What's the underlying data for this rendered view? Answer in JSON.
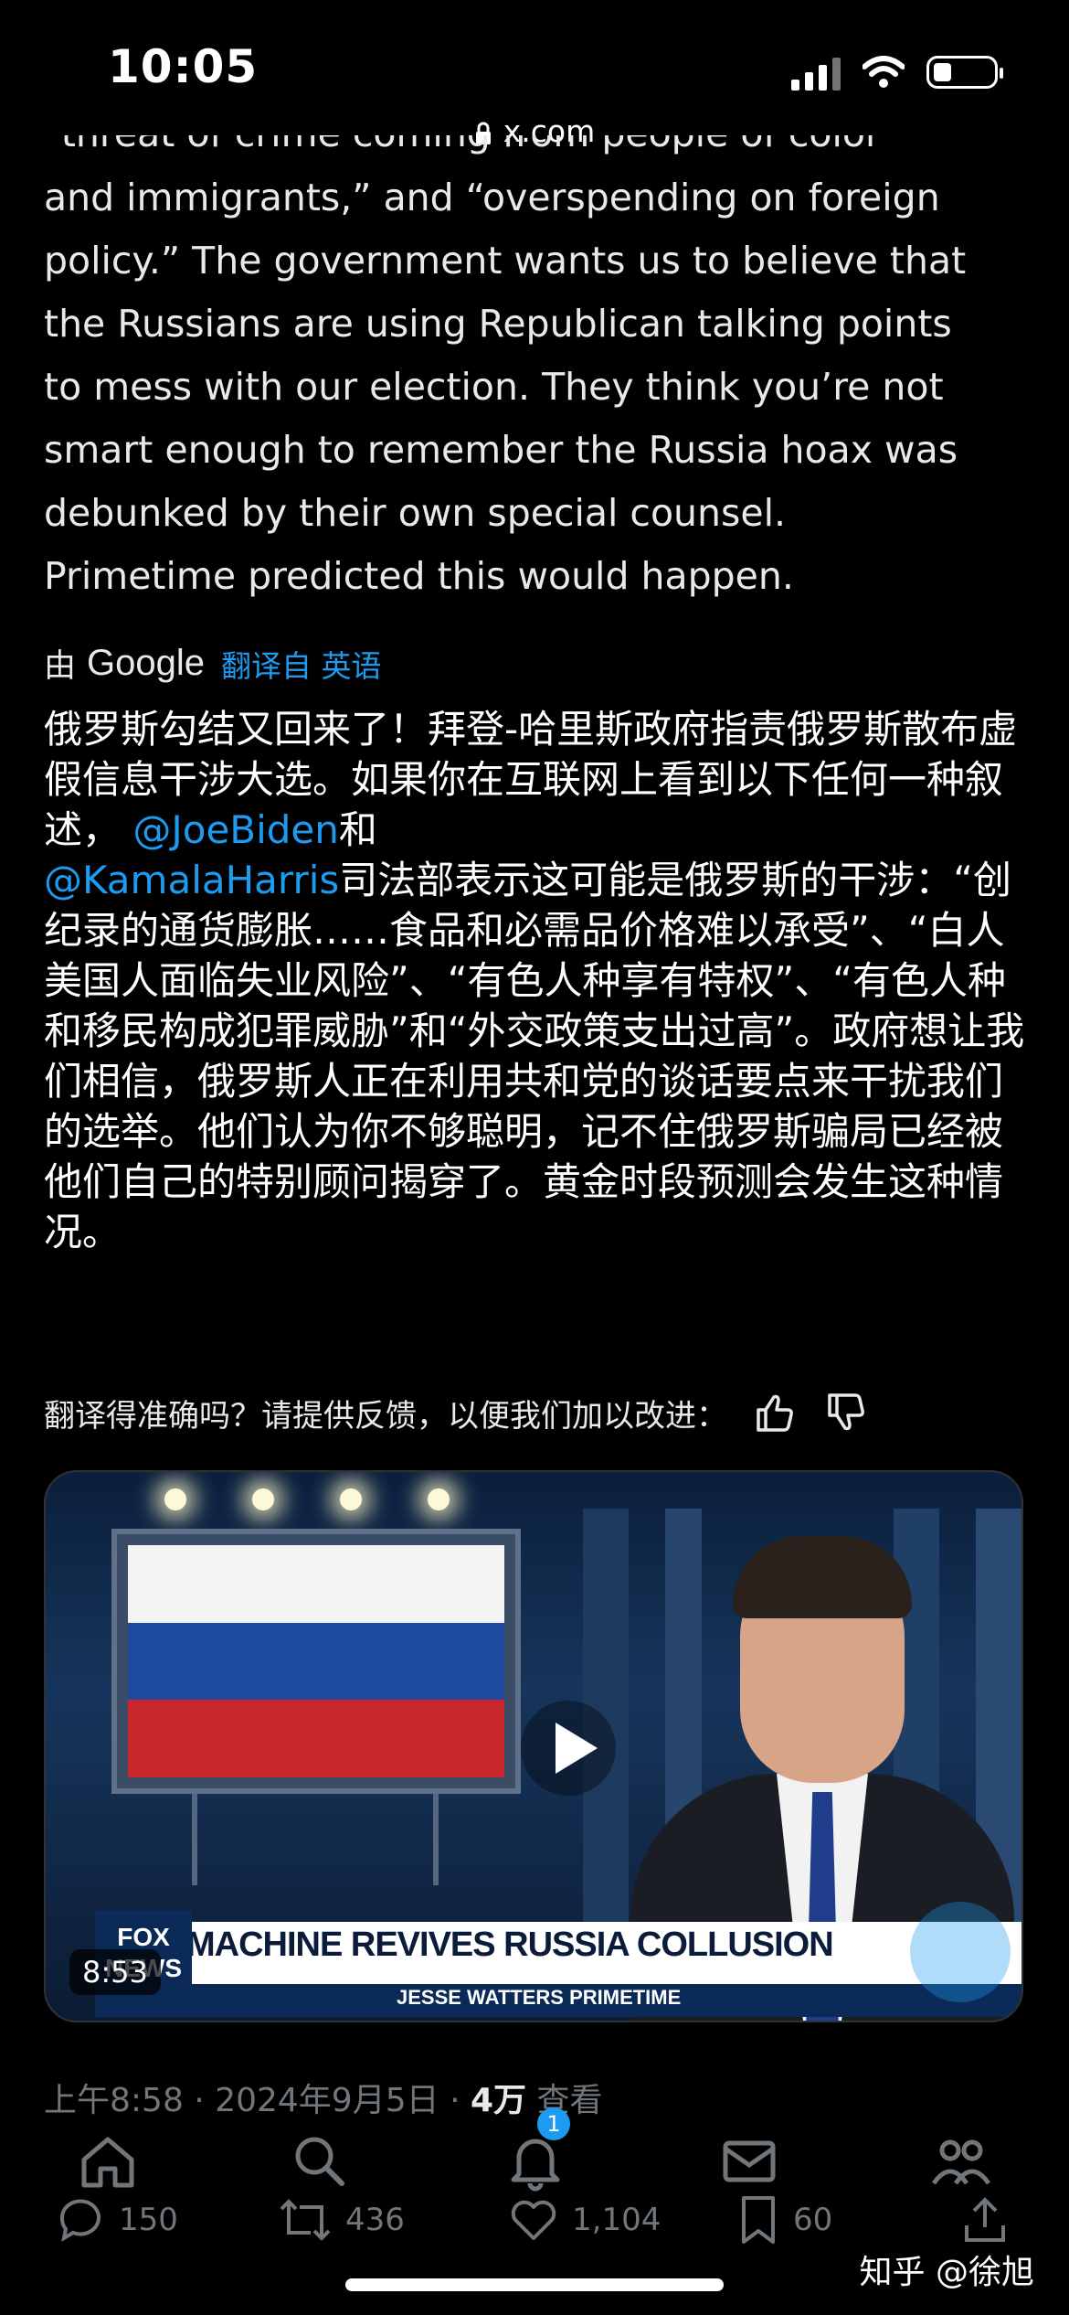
{
  "status_bar": {
    "time": "10:05",
    "battery_level": 0.3
  },
  "browser": {
    "url": "x.com"
  },
  "tweet": {
    "cut_line": "\"threat of crime coming from people of color",
    "text_lines": [
      "and immigrants,” and “overspending on foreign",
      "policy.” The government wants us to believe that",
      "the Russians are using Republican talking points",
      "to mess with our election. They think you’re not",
      "smart enough to remember the Russia hoax was",
      "debunked by their own special counsel.",
      "Primetime predicted this would happen."
    ],
    "translated_by": "由",
    "translator": "Google",
    "translate_link": "翻译自 英语",
    "translation_part1": "俄罗斯勾结又回来了！拜登-哈里斯政府指责俄罗斯散布虚假信息干涉大选。如果你在互联网上看到以下任何一种叙述， ",
    "mention1": "@JoeBiden",
    "translation_part2": "和",
    "mention2": "@KamalaHarris",
    "translation_part3": "司法部表示这可能是俄罗斯的干涉：“创纪录的通货膨胀……食品和必需品价格难以承受”、“白人美国人面临失业风险”、“有色人种享有特权”、“有色人种和移民构成犯罪威胁”和“外交政策支出过高”。政府想让我们相信，俄罗斯人正在利用共和党的谈话要点来干扰我们的选举。他们认为你不够聪明，记不住俄罗斯骗局已经被他们自己的特别顾问揭穿了。黄金时段预测会发生这种情况。",
    "feedback_prompt": "翻译得准确吗？请提供反馈，以便我们加以改进：",
    "video": {
      "headline": "MACHINE REVIVES RUSSIA COLLUSION",
      "show": "JESSE WATTERS PRIMETIME",
      "network_logo": "FOX NEWS",
      "duration": "8:53"
    },
    "meta": {
      "time": "上午8:58",
      "date": "2024年9月5日",
      "views": "4万",
      "views_label": "查看"
    },
    "actions": {
      "replies": "150",
      "retweets": "436",
      "likes": "1,104",
      "bookmarks": "60"
    }
  },
  "nav": {
    "notification_count": "1"
  },
  "watermark": "知乎 @徐旭",
  "colors": {
    "accent": "#1d9bf0",
    "background": "#000000",
    "muted": "#71767b"
  }
}
